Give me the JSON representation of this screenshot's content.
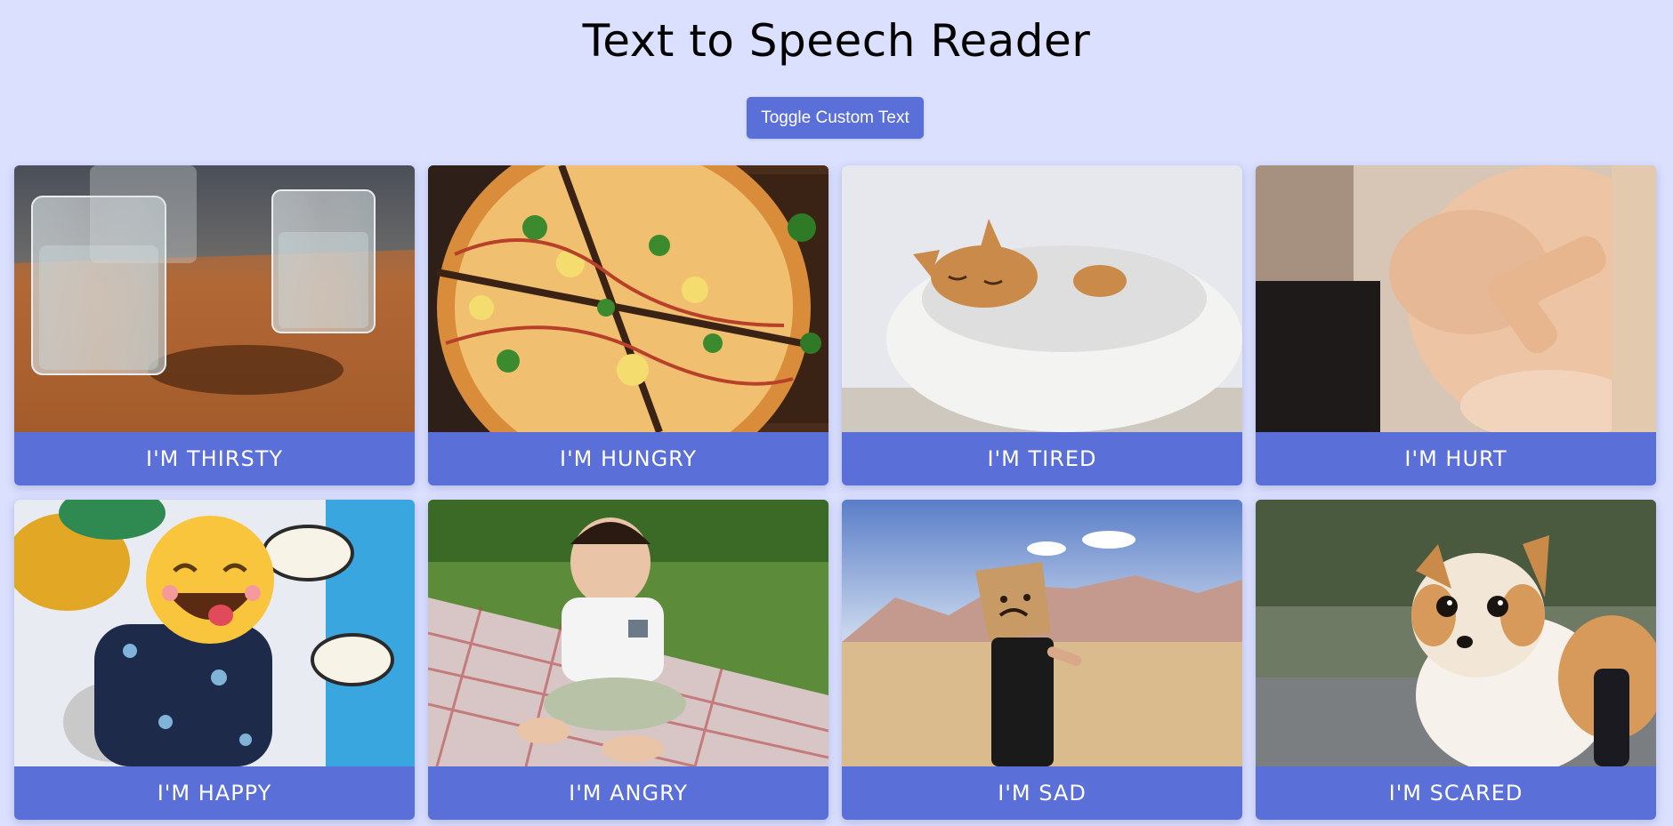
{
  "header": {
    "title": "Text to Speech Reader",
    "toggle_label": "Toggle Custom Text"
  },
  "cards": [
    {
      "label": "I'M THIRSTY",
      "image": "glasses-of-water"
    },
    {
      "label": "I'M HUNGRY",
      "image": "pizza"
    },
    {
      "label": "I'M TIRED",
      "image": "sleeping-cat"
    },
    {
      "label": "I'M HURT",
      "image": "bandage-on-elbow"
    },
    {
      "label": "I'M HAPPY",
      "image": "smiley-balloon"
    },
    {
      "label": "I'M ANGRY",
      "image": "grumpy-baby"
    },
    {
      "label": "I'M SAD",
      "image": "paper-bag-sad-face"
    },
    {
      "label": "I'M SCARED",
      "image": "scared-dog"
    }
  ],
  "colors": {
    "background": "#dbe0ff",
    "accent": "#5a6fd8",
    "caption_text": "#ffffff"
  }
}
